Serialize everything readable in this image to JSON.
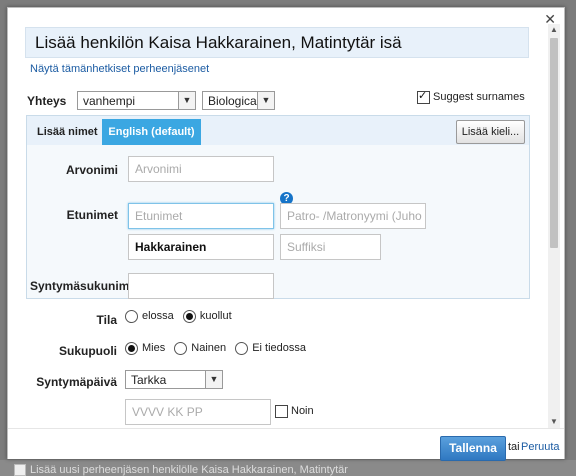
{
  "dialog": {
    "title": "Lisää henkilön Kaisa Hakkarainen, Matintytär isä",
    "show_members_link": "Näytä tämänhetkiset perheenjäsenet"
  },
  "relation": {
    "label": "Yhteys",
    "role_value": "vanhempi",
    "type_value": "Biological",
    "suggest_surnames_label": "Suggest surnames",
    "suggest_surnames_checked": true
  },
  "names": {
    "tab_add_names_label": "Lisää nimet",
    "tab_active_label": "English (default)",
    "add_language_button": "Lisää kieli...",
    "title_label": "Arvonimi",
    "title_placeholder": "Arvonimi",
    "given_label": "Etunimet",
    "given_placeholder": "Etunimet",
    "patronymic_placeholder": "Patro- /Matronyymi (Juho",
    "surname_value": "Hakkarainen",
    "suffix_placeholder": "Suffiksi",
    "birth_surname_label": "Syntymäsukunimi",
    "help_icon": "question-circle-icon"
  },
  "status": {
    "label": "Tila",
    "options": [
      "elossa",
      "kuollut"
    ],
    "selected": "kuollut"
  },
  "gender": {
    "label": "Sukupuoli",
    "options": [
      "Mies",
      "Nainen",
      "Ei tiedossa"
    ],
    "selected": "Mies"
  },
  "birth": {
    "label": "Syntymäpäivä",
    "precision_value": "Tarkka",
    "date_placeholder": "VVVV KK PP",
    "approx_label": "Noin"
  },
  "footer": {
    "save_label": "Tallenna",
    "or_label": "tai",
    "cancel_label": "Peruuta"
  },
  "background": {
    "text": "Lisää uusi perheenjäsen henkilölle Kaisa Hakkarainen, Matintytär"
  },
  "colors": {
    "accent_tab": "#3ba7e2",
    "save_button": "#2f78c1",
    "link": "#1c5ca3",
    "title_bg": "#e8f1fa"
  }
}
